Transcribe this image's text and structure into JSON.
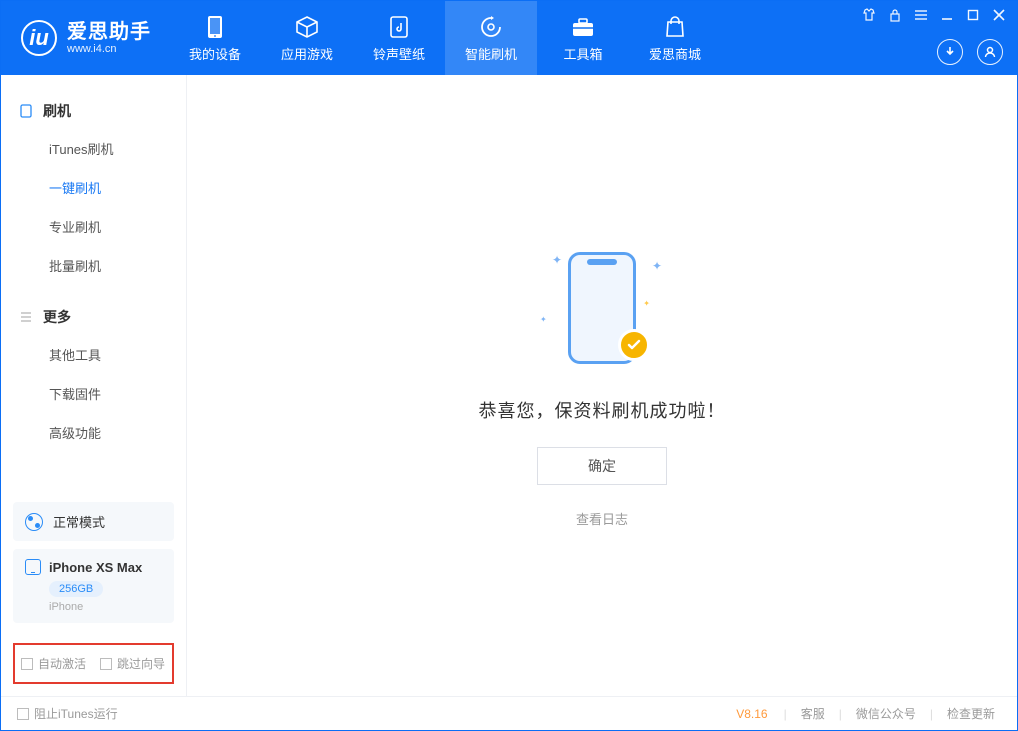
{
  "app": {
    "name_cn": "爱思助手",
    "name_en": "www.i4.cn"
  },
  "tabs": [
    {
      "label": "我的设备"
    },
    {
      "label": "应用游戏"
    },
    {
      "label": "铃声壁纸"
    },
    {
      "label": "智能刷机"
    },
    {
      "label": "工具箱"
    },
    {
      "label": "爱思商城"
    }
  ],
  "sidebar": {
    "group1": {
      "title": "刷机",
      "items": [
        {
          "label": "iTunes刷机"
        },
        {
          "label": "一键刷机"
        },
        {
          "label": "专业刷机"
        },
        {
          "label": "批量刷机"
        }
      ]
    },
    "group2": {
      "title": "更多",
      "items": [
        {
          "label": "其他工具"
        },
        {
          "label": "下载固件"
        },
        {
          "label": "高级功能"
        }
      ]
    },
    "mode_label": "正常模式",
    "device": {
      "name": "iPhone XS Max",
      "storage": "256GB",
      "type": "iPhone"
    },
    "options": {
      "auto_activate": "自动激活",
      "skip_guide": "跳过向导"
    }
  },
  "main": {
    "success_message": "恭喜您，保资料刷机成功啦！",
    "ok_button": "确定",
    "view_log": "查看日志"
  },
  "footer": {
    "block_itunes": "阻止iTunes运行",
    "version": "V8.16",
    "links": {
      "support": "客服",
      "wechat": "微信公众号",
      "check_update": "检查更新"
    }
  }
}
